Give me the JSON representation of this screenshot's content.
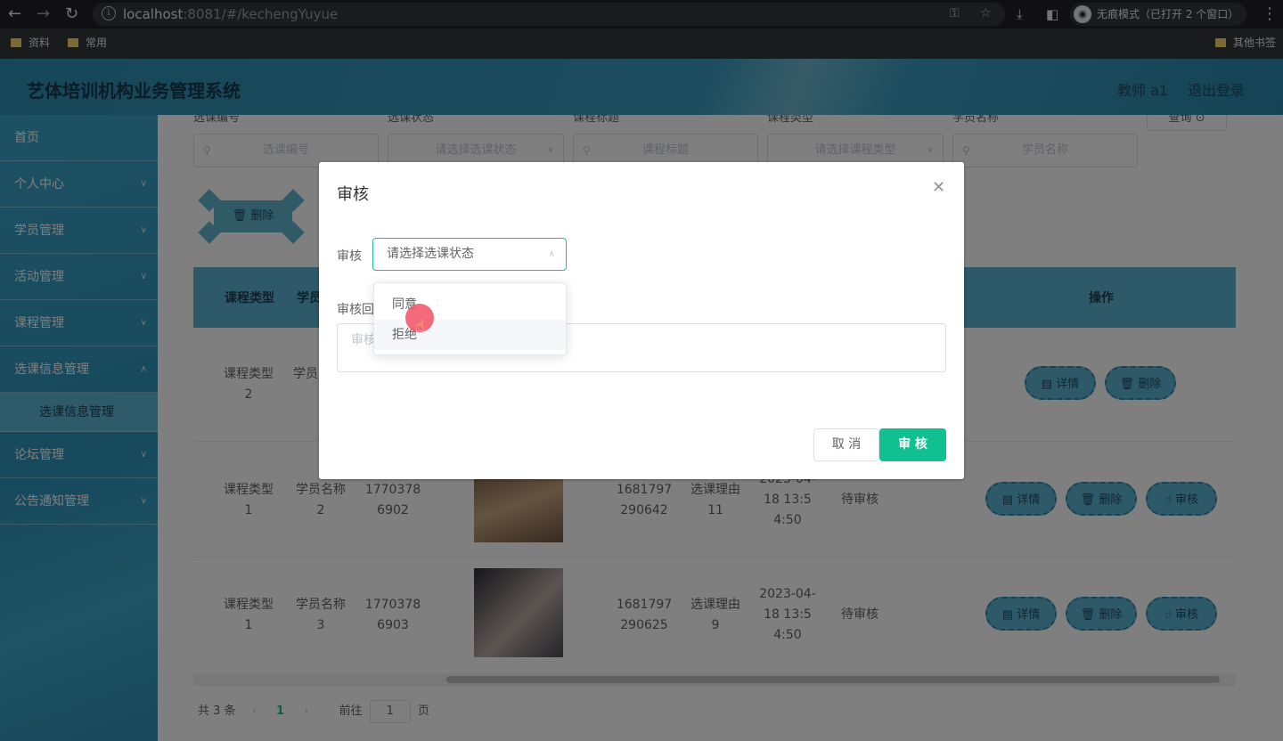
{
  "browser": {
    "url_host": "localhost",
    "url_rest": ":8081/#/kechengYuyue",
    "incognito_label": "无痕模式（已打开 2 个窗口）",
    "bookmarks": [
      "资料",
      "常用"
    ],
    "other_bookmarks": "其他书签"
  },
  "header": {
    "title": "艺体培训机构业务管理系统",
    "user": "教师 a1",
    "logout": "退出登录"
  },
  "sidebar": {
    "items": [
      "首页",
      "个人中心",
      "学员管理",
      "活动管理",
      "课程管理",
      "选课信息管理",
      "论坛管理",
      "公告通知管理"
    ],
    "active_sub": "选课信息管理"
  },
  "filters": {
    "labels": [
      "选课编号",
      "选课状态",
      "课程标题",
      "课程类型",
      "学员名称"
    ],
    "placeholders": [
      "选课编号",
      "请选择选课状态",
      "课程标题",
      "请选择课程类型",
      "学员名称"
    ],
    "query_button": "查询"
  },
  "toolbar": {
    "batch_delete": "删除"
  },
  "table": {
    "headers": {
      "course_type": "课程类型",
      "student": "学员",
      "ops": "操作"
    },
    "rows": [
      {
        "course_type": "课程类型2",
        "student": "学员"
      },
      {
        "course_type": "课程类型1",
        "student": "学员名称2",
        "phone": "17703786902",
        "id": "1681797290642",
        "reason": "选课理由11",
        "time": "2023-04-18 13:54:50",
        "status": "待审核"
      },
      {
        "course_type": "课程类型1",
        "student": "学员名称3",
        "phone": "17703786903",
        "id": "1681797290625",
        "reason": "选课理由9",
        "time": "2023-04-18 13:54:50",
        "status": "待审核"
      }
    ],
    "ops": {
      "detail": "详情",
      "delete": "删除",
      "review": "审核"
    }
  },
  "pager": {
    "total": "共 3 条",
    "current": "1",
    "goto": "前往",
    "page_value": "1",
    "page_unit": "页"
  },
  "dialog": {
    "title": "审核",
    "review_label": "审核",
    "select_placeholder": "请选择选课状态",
    "reply_label": "审核回",
    "reply_placeholder": "审核",
    "cancel": "取 消",
    "ok": "审 核",
    "options": [
      "同意",
      "拒绝"
    ]
  }
}
